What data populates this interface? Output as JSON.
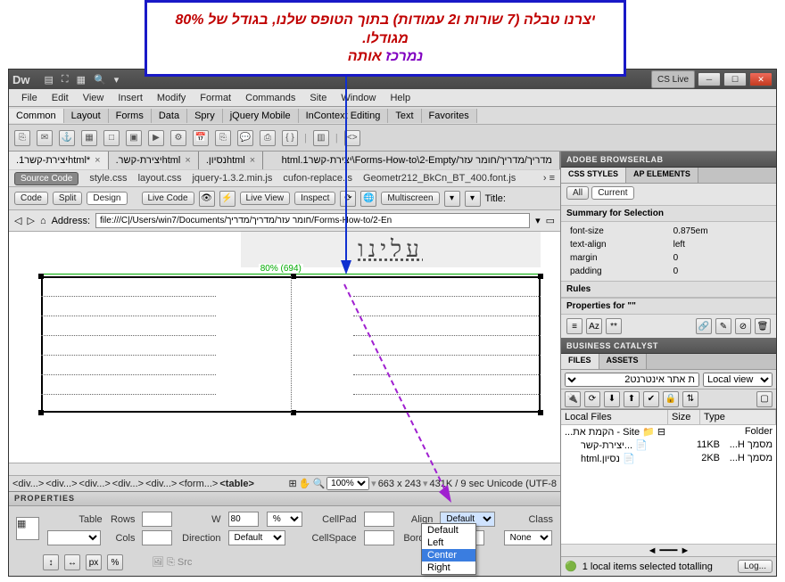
{
  "callout": {
    "line1": "יצרנו טבלה (7 שורות ו2 עמודות) בתוך הטופס שלנו, בגודל של 80% מגודלו.",
    "line2a": "נמרכז",
    "line2b": " אותה"
  },
  "titlebar": {
    "cslive": "CS Live"
  },
  "menu": [
    "File",
    "Edit",
    "View",
    "Insert",
    "Modify",
    "Format",
    "Commands",
    "Site",
    "Window",
    "Help"
  ],
  "tbcats": [
    "Common",
    "Layout",
    "Forms",
    "Data",
    "Spry",
    "jQuery Mobile",
    "InContext Editing",
    "Text",
    "Favorites"
  ],
  "doctabs": [
    {
      "label": ".יצירת-קשר1html*",
      "active": true
    },
    {
      "label": ".יצירת-קשרhtml",
      "active": false
    },
    {
      "label": ".נסיוןhtml",
      "active": false
    },
    {
      "label": "מדריך/מדריך/חומר עזר/Forms-How-to\\2-Empty\\יצירת-קשר1.html",
      "active": false
    }
  ],
  "srcrow": {
    "sourcecode": "Source Code",
    "files": [
      "style.css",
      "layout.css",
      "jquery-1.3.2.min.js",
      "cufon-replace.js",
      "Geometr212_BkCn_BT_400.font.js"
    ]
  },
  "viewbtns": {
    "code": "Code",
    "split": "Split",
    "design": "Design",
    "livecode": "Live Code",
    "liveview": "Live View",
    "inspect": "Inspect",
    "multiscreen": "Multiscreen",
    "title": "Title:"
  },
  "address": {
    "label": "Address:",
    "value": "file:///C|/Users/win7/Documents/חומר עזר/מדריך/מדריך/Forms-How-to/2-En"
  },
  "canvas": {
    "heading": "עלינו",
    "widthlabel": "80% (694)"
  },
  "tagpath": [
    "<div...>",
    "<div...>",
    "<div...>",
    "<div...>",
    "<div...>",
    "<form...>",
    "<table>"
  ],
  "tagright": {
    "zoom": "100%",
    "dims": "663 x 243",
    "info": "431K / 9 sec  Unicode (UTF-8"
  },
  "props": {
    "title": "PROPERTIES",
    "tableLabel": "Table",
    "rows": "Rows",
    "cols": "Cols",
    "w": "W",
    "wval": "80",
    "wunit": "%",
    "direction": "Direction",
    "directionVal": "Default",
    "cellpad": "CellPad",
    "cellspace": "CellSpace",
    "align": "Align",
    "alignVal": "Default",
    "border": "Border",
    "class": "Class",
    "classVal": "None",
    "alignOptions": [
      "Default",
      "Left",
      "Center",
      "Right"
    ]
  },
  "right": {
    "browserlab": "ADOBE BROWSERLAB",
    "csstab": "CSS STYLES",
    "aptab": "AP ELEMENTS",
    "all": "All",
    "current": "Current",
    "summary": "Summary for Selection",
    "cssrows": [
      [
        "font-size",
        "0.875em"
      ],
      [
        "text-align",
        "left"
      ],
      [
        "margin",
        "0"
      ],
      [
        "padding",
        "0"
      ]
    ],
    "rules": "Rules",
    "propsfor": "Properties for \"\"",
    "buscat": "BUSINESS CATALYST",
    "filestab": "FILES",
    "assetstab": "ASSETS",
    "site": "ת אתר אינטרנט2",
    "localview": "Local view",
    "cols": [
      "Local Files",
      "Size",
      "Type"
    ],
    "treerows": [
      {
        "name": "Site - הקמת את...",
        "size": "",
        "type": "Folder"
      },
      {
        "name": "...יצירת-קשר",
        "size": "11KB",
        "type": "מסמך H..."
      },
      {
        "name": "נסיון.html",
        "size": "2KB",
        "type": "מסמך H..."
      }
    ],
    "status": "1 local items selected totalling",
    "logbtn": "Log..."
  }
}
